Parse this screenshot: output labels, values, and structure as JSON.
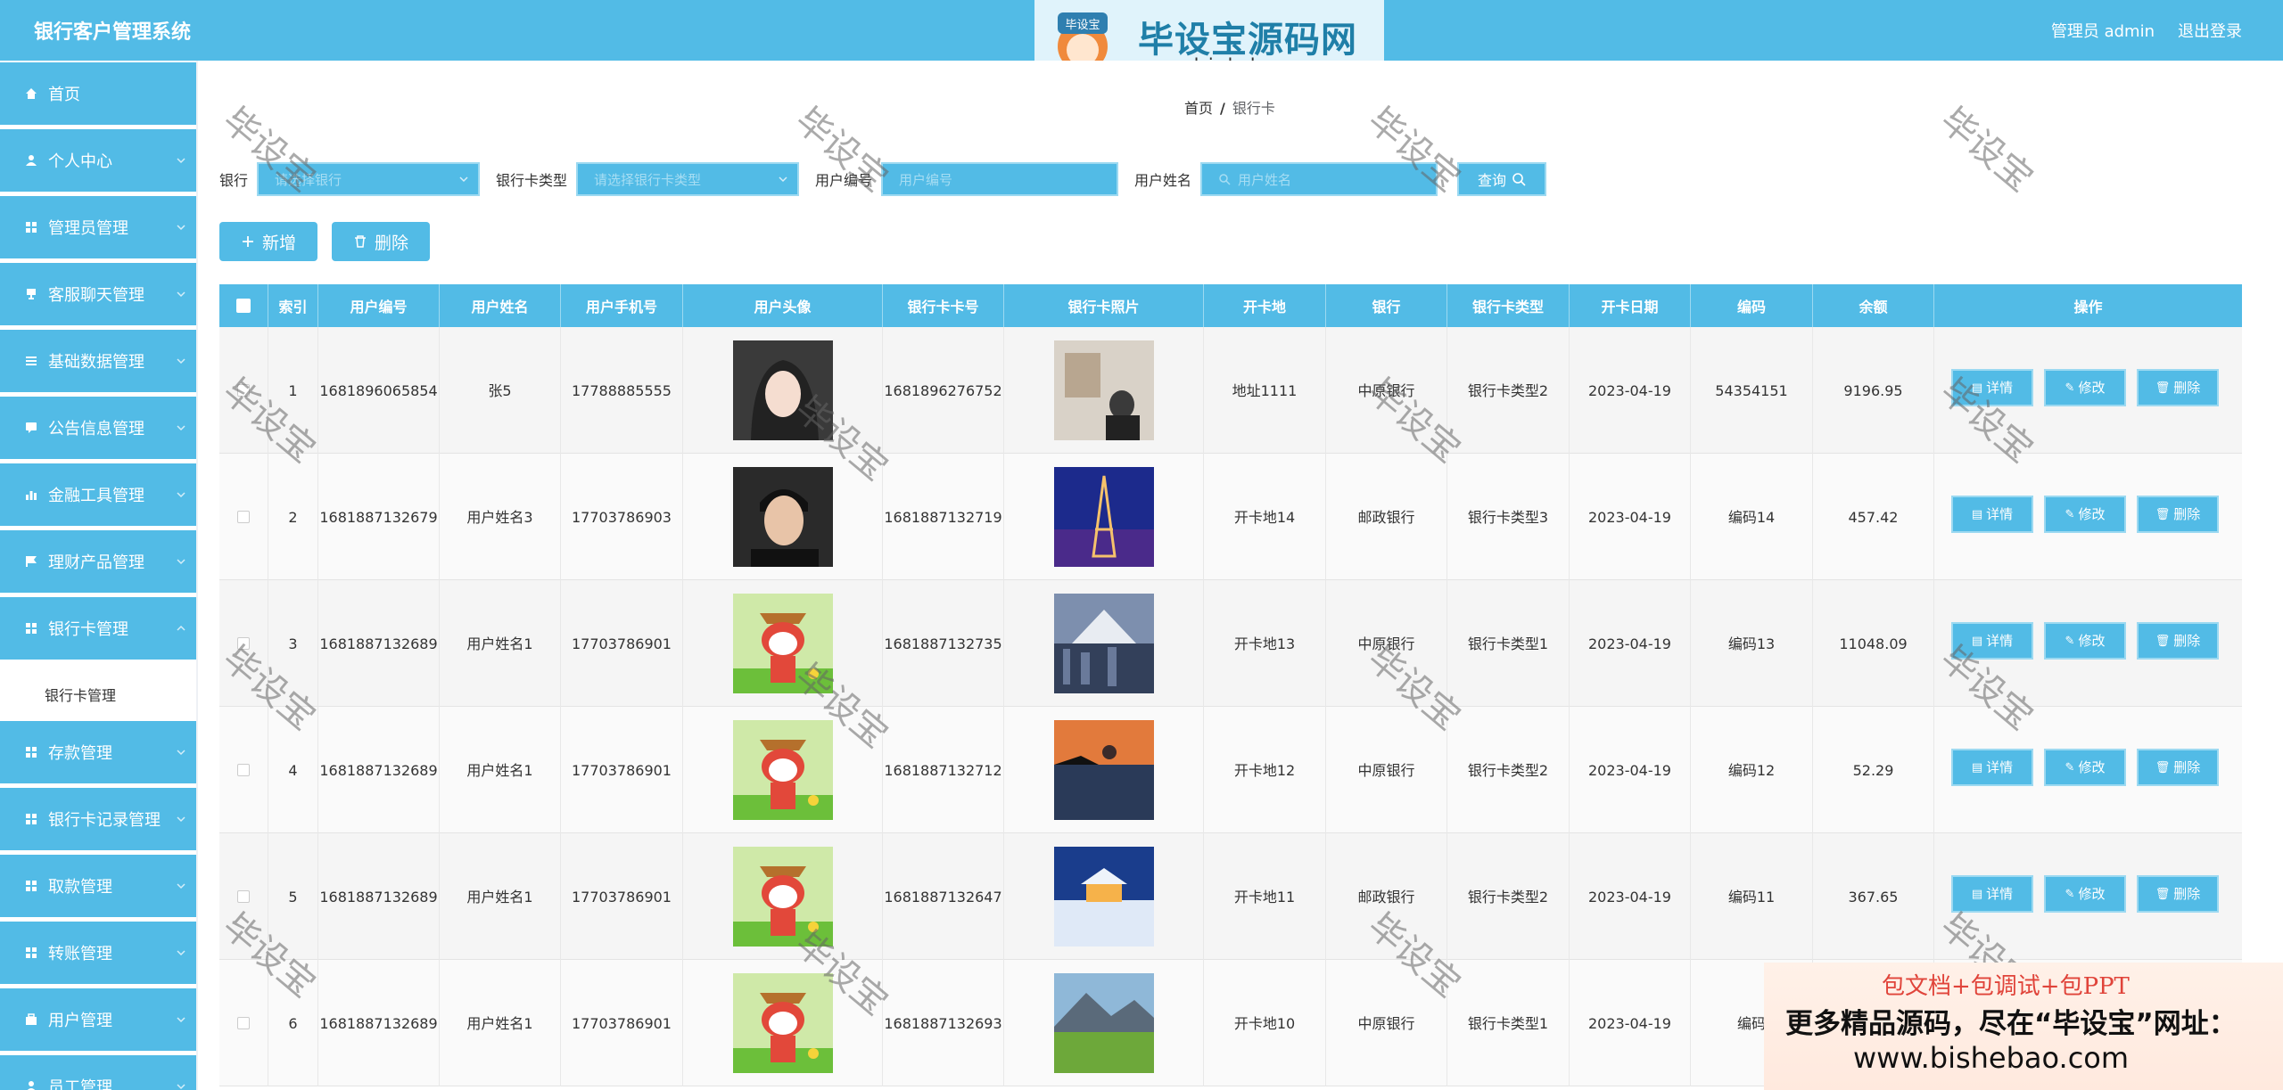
{
  "header": {
    "app_title": "银行客户管理系统",
    "admin_label": "管理员 admin",
    "logout_label": "退出登录"
  },
  "watermark": {
    "logo_text": "毕设宝源码网",
    "logo_badge": "毕设宝",
    "url": "www.bishebao.com",
    "diag_text": "毕设宝"
  },
  "sidebar": {
    "items": [
      {
        "label": "首页",
        "icon": "home-icon"
      },
      {
        "label": "个人中心",
        "icon": "user-icon"
      },
      {
        "label": "管理员管理",
        "icon": "grid-icon"
      },
      {
        "label": "客服聊天管理",
        "icon": "trophy-icon"
      },
      {
        "label": "基础数据管理",
        "icon": "list-icon"
      },
      {
        "label": "公告信息管理",
        "icon": "chat-icon"
      },
      {
        "label": "金融工具管理",
        "icon": "chart-icon"
      },
      {
        "label": "理财产品管理",
        "icon": "flag-icon"
      },
      {
        "label": "银行卡管理",
        "icon": "grid-icon"
      },
      {
        "label": "存款管理",
        "icon": "grid-icon"
      },
      {
        "label": "银行卡记录管理",
        "icon": "grid-icon"
      },
      {
        "label": "取款管理",
        "icon": "grid-icon"
      },
      {
        "label": "转账管理",
        "icon": "grid-icon"
      },
      {
        "label": "用户管理",
        "icon": "briefcase-icon"
      },
      {
        "label": "员工管理",
        "icon": "user-icon"
      }
    ],
    "sub_item": "银行卡管理"
  },
  "breadcrumb": {
    "home": "首页",
    "sep": "/",
    "current": "银行卡"
  },
  "filters": {
    "bank_label": "银行",
    "bank_placeholder": "请选择银行",
    "card_type_label": "银行卡类型",
    "card_type_placeholder": "请选择银行卡类型",
    "user_no_label": "用户编号",
    "user_no_placeholder": "用户编号",
    "user_name_label": "用户姓名",
    "user_name_placeholder": "用户姓名",
    "query_label": "查询"
  },
  "actions": {
    "add_label": "新增",
    "delete_label": "删除"
  },
  "table": {
    "columns": [
      "索引",
      "用户编号",
      "用户姓名",
      "用户手机号",
      "用户头像",
      "银行卡卡号",
      "银行卡照片",
      "开卡地",
      "银行",
      "银行卡类型",
      "开卡日期",
      "编码",
      "余额",
      "操作"
    ],
    "op_labels": {
      "detail": "详情",
      "edit": "修改",
      "delete": "删除"
    },
    "rows": [
      {
        "index": "1",
        "user_no": "1681896065854",
        "user_name": "张5",
        "phone": "17788885555",
        "avatar": "woman-portrait",
        "card_no": "1681896276752",
        "card_photo": "person-photo",
        "place": "地址1111",
        "bank": "中原银行",
        "card_type": "银行卡类型2",
        "date": "2023-04-19",
        "code": "54354151",
        "balance": "9196.95"
      },
      {
        "index": "2",
        "user_no": "1681887132679",
        "user_name": "用户姓名3",
        "phone": "17703786903",
        "avatar": "man-portrait",
        "card_no": "1681887132719",
        "card_photo": "eiffel-tower",
        "place": "开卡地14",
        "bank": "邮政银行",
        "card_type": "银行卡类型3",
        "date": "2023-04-19",
        "code": "编码14",
        "balance": "457.42"
      },
      {
        "index": "3",
        "user_no": "1681887132689",
        "user_name": "用户姓名1",
        "phone": "17703786901",
        "avatar": "cartoon-fox",
        "card_no": "1681887132735",
        "card_photo": "city-mountain",
        "place": "开卡地13",
        "bank": "中原银行",
        "card_type": "银行卡类型1",
        "date": "2023-04-19",
        "code": "编码13",
        "balance": "11048.09"
      },
      {
        "index": "4",
        "user_no": "1681887132689",
        "user_name": "用户姓名1",
        "phone": "17703786901",
        "avatar": "cartoon-fox",
        "card_no": "1681887132712",
        "card_photo": "sunset-lake",
        "place": "开卡地12",
        "bank": "中原银行",
        "card_type": "银行卡类型2",
        "date": "2023-04-19",
        "code": "编码12",
        "balance": "52.29"
      },
      {
        "index": "5",
        "user_no": "1681887132689",
        "user_name": "用户姓名1",
        "phone": "17703786901",
        "avatar": "cartoon-fox",
        "card_no": "1681887132647",
        "card_photo": "snow-cabin",
        "place": "开卡地11",
        "bank": "邮政银行",
        "card_type": "银行卡类型2",
        "date": "2023-04-19",
        "code": "编码11",
        "balance": "367.65"
      },
      {
        "index": "6",
        "user_no": "1681887132689",
        "user_name": "用户姓名1",
        "phone": "17703786901",
        "avatar": "cartoon-fox",
        "card_no": "1681887132693",
        "card_photo": "mountain-meadow",
        "place": "开卡地10",
        "bank": "中原银行",
        "card_type": "银行卡类型1",
        "date": "2023-04-19",
        "code": "编码",
        "balance": ""
      }
    ]
  },
  "ad": {
    "line1": "包文档+包调试+包PPT",
    "line2": "更多精品源码，尽在“毕设宝”网址：",
    "line3": "www.bishebao.com"
  },
  "colors": {
    "accent": "#52bbe6",
    "accent_border": "#9cd9f1"
  }
}
